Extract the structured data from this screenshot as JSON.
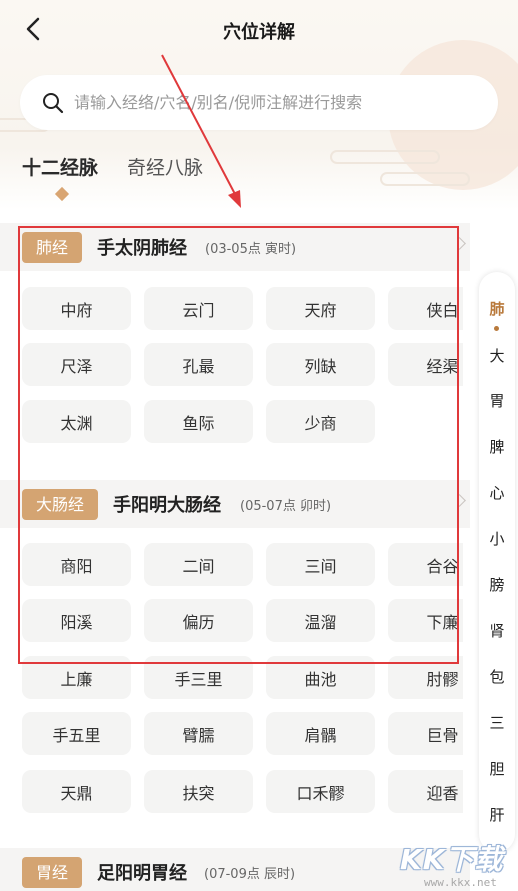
{
  "header": {
    "title": "穴位详解"
  },
  "search": {
    "placeholder": "请输入经络/穴名/别名/倪师注解进行搜索"
  },
  "tabs": [
    {
      "label": "十二经脉",
      "active": true
    },
    {
      "label": "奇经八脉",
      "active": false
    }
  ],
  "sections": [
    {
      "badge": "肺经",
      "name": "手太阴肺经",
      "time": "(03-05点 寅时)",
      "points": [
        "中府",
        "云门",
        "天府",
        "侠白",
        "尺泽",
        "孔最",
        "列缺",
        "经渠",
        "太渊",
        "鱼际",
        "少商"
      ]
    },
    {
      "badge": "大肠经",
      "name": "手阳明大肠经",
      "time": "(05-07点 卯时)",
      "points": [
        "商阳",
        "二间",
        "三间",
        "合谷",
        "阳溪",
        "偏历",
        "温溜",
        "下廉",
        "上廉",
        "手三里",
        "曲池",
        "肘髎",
        "手五里",
        "臂臑",
        "肩髃",
        "巨骨",
        "天鼎",
        "扶突",
        "口禾髎",
        "迎香"
      ]
    },
    {
      "badge": "胃经",
      "name": "足阳明胃经",
      "time": "(07-09点 辰时)",
      "points": []
    }
  ],
  "side_index": [
    "肺",
    "大",
    "胃",
    "脾",
    "心",
    "小",
    "膀",
    "肾",
    "包",
    "三",
    "胆",
    "肝"
  ],
  "side_index_active": "肺",
  "watermark": {
    "text": "KK下载",
    "url": "www.kkx.net"
  },
  "colors": {
    "accent": "#d4a472",
    "annotation": "#e0393b",
    "button_bg": "#f4f4f3"
  }
}
